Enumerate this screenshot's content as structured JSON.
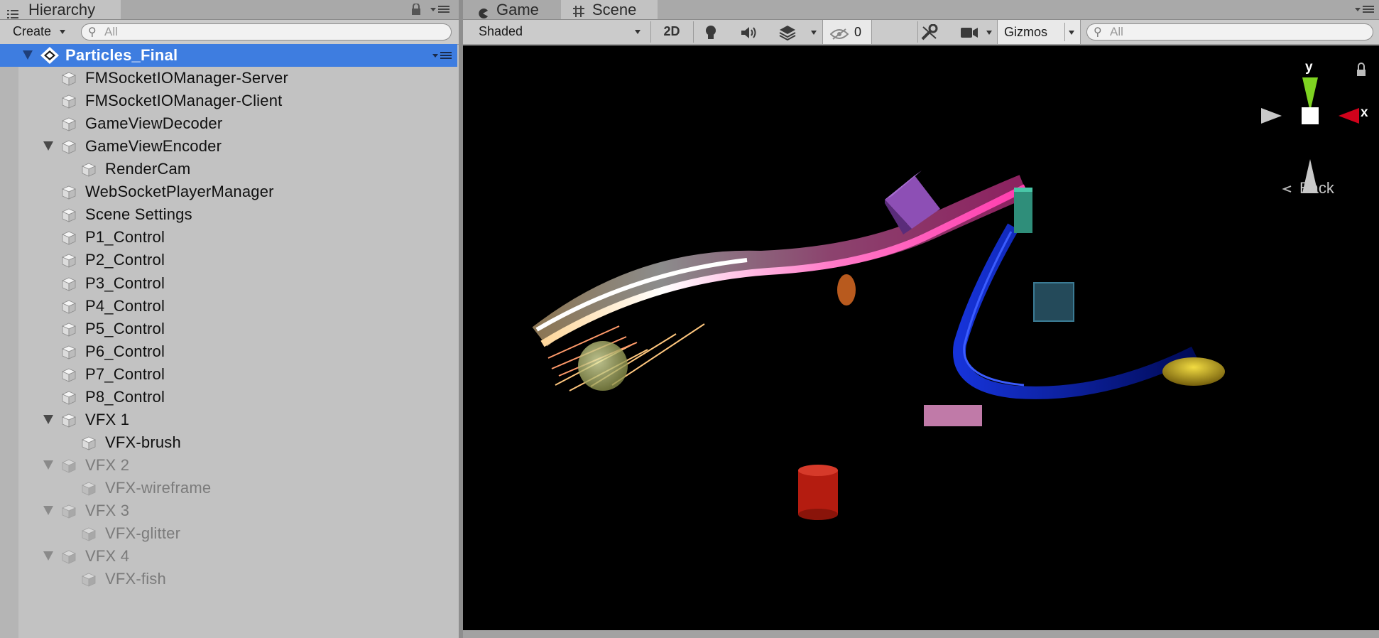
{
  "hierarchy": {
    "tab_label": "Hierarchy",
    "create_label": "Create",
    "search_placeholder": "All",
    "scene_name": "Particles_Final",
    "items": [
      {
        "label": "FMSocketIOManager-Server",
        "dim": false,
        "indent": 1,
        "expander": false
      },
      {
        "label": "FMSocketIOManager-Client",
        "dim": false,
        "indent": 1,
        "expander": false
      },
      {
        "label": "GameViewDecoder",
        "dim": false,
        "indent": 1,
        "expander": false
      },
      {
        "label": "GameViewEncoder",
        "dim": false,
        "indent": 1,
        "expander": true
      },
      {
        "label": "RenderCam",
        "dim": false,
        "indent": 2,
        "expander": false
      },
      {
        "label": "WebSocketPlayerManager",
        "dim": false,
        "indent": 1,
        "expander": false
      },
      {
        "label": "Scene Settings",
        "dim": false,
        "indent": 1,
        "expander": false
      },
      {
        "label": "P1_Control",
        "dim": false,
        "indent": 1,
        "expander": false
      },
      {
        "label": "P2_Control",
        "dim": false,
        "indent": 1,
        "expander": false
      },
      {
        "label": "P3_Control",
        "dim": false,
        "indent": 1,
        "expander": false
      },
      {
        "label": "P4_Control",
        "dim": false,
        "indent": 1,
        "expander": false
      },
      {
        "label": "P5_Control",
        "dim": false,
        "indent": 1,
        "expander": false
      },
      {
        "label": "P6_Control",
        "dim": false,
        "indent": 1,
        "expander": false
      },
      {
        "label": "P7_Control",
        "dim": false,
        "indent": 1,
        "expander": false
      },
      {
        "label": "P8_Control",
        "dim": false,
        "indent": 1,
        "expander": false
      },
      {
        "label": "VFX 1",
        "dim": false,
        "indent": 1,
        "expander": true
      },
      {
        "label": "VFX-brush",
        "dim": false,
        "indent": 2,
        "expander": false
      },
      {
        "label": "VFX 2",
        "dim": true,
        "indent": 1,
        "expander": true
      },
      {
        "label": "VFX-wireframe",
        "dim": true,
        "indent": 2,
        "expander": false
      },
      {
        "label": "VFX 3",
        "dim": true,
        "indent": 1,
        "expander": true
      },
      {
        "label": "VFX-glitter",
        "dim": true,
        "indent": 2,
        "expander": false
      },
      {
        "label": "VFX 4",
        "dim": true,
        "indent": 1,
        "expander": true
      },
      {
        "label": "VFX-fish",
        "dim": true,
        "indent": 2,
        "expander": false
      }
    ]
  },
  "scene": {
    "tab_game": "Game",
    "tab_scene": "Scene",
    "draw_mode": "Shaded",
    "btn_2d": "2D",
    "hidden_count": "0",
    "gizmos_label": "Gizmos",
    "search_placeholder": "All",
    "axis_y": "y",
    "axis_x": "x",
    "back_label": "Back"
  },
  "colors": {
    "selection": "#3e7de0",
    "viewport_bg": "#000000",
    "gizmo_y": "#7ed321",
    "gizmo_x": "#d0021b",
    "trail_pink": "#ff6fc3",
    "trail_blue": "#1a3cff"
  },
  "icons": {
    "hierarchy": "list-icon",
    "lock": "lock-icon",
    "menu": "panel-menu-icon",
    "game": "pacman-icon",
    "scene": "grid-icon",
    "lighting": "lightbulb-icon",
    "audio": "speaker-icon",
    "effects": "layers-icon",
    "visibility": "eye-slash-icon",
    "tools": "wrench-icon",
    "camera": "camera-icon"
  }
}
